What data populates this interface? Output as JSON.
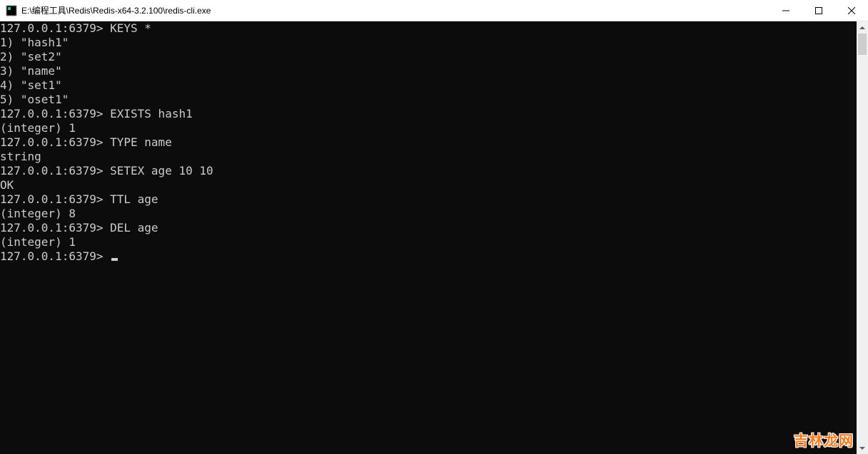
{
  "window": {
    "title": "E:\\编程工具\\Redis\\Redis-x64-3.2.100\\redis-cli.exe"
  },
  "prompt": "127.0.0.1:6379>",
  "session": [
    {
      "type": "cmd",
      "text": "KEYS *"
    },
    {
      "type": "out",
      "text": "1) \"hash1\""
    },
    {
      "type": "out",
      "text": "2) \"set2\""
    },
    {
      "type": "out",
      "text": "3) \"name\""
    },
    {
      "type": "out",
      "text": "4) \"set1\""
    },
    {
      "type": "out",
      "text": "5) \"oset1\""
    },
    {
      "type": "cmd",
      "text": "EXISTS hash1"
    },
    {
      "type": "out",
      "text": "(integer) 1"
    },
    {
      "type": "cmd",
      "text": "TYPE name"
    },
    {
      "type": "out",
      "text": "string"
    },
    {
      "type": "cmd",
      "text": "SETEX age 10 10"
    },
    {
      "type": "out",
      "text": "OK"
    },
    {
      "type": "cmd",
      "text": "TTL age"
    },
    {
      "type": "out",
      "text": "(integer) 8"
    },
    {
      "type": "cmd",
      "text": "DEL age"
    },
    {
      "type": "out",
      "text": "(integer) 1"
    },
    {
      "type": "cursor"
    }
  ],
  "watermark": "吉林龙网"
}
